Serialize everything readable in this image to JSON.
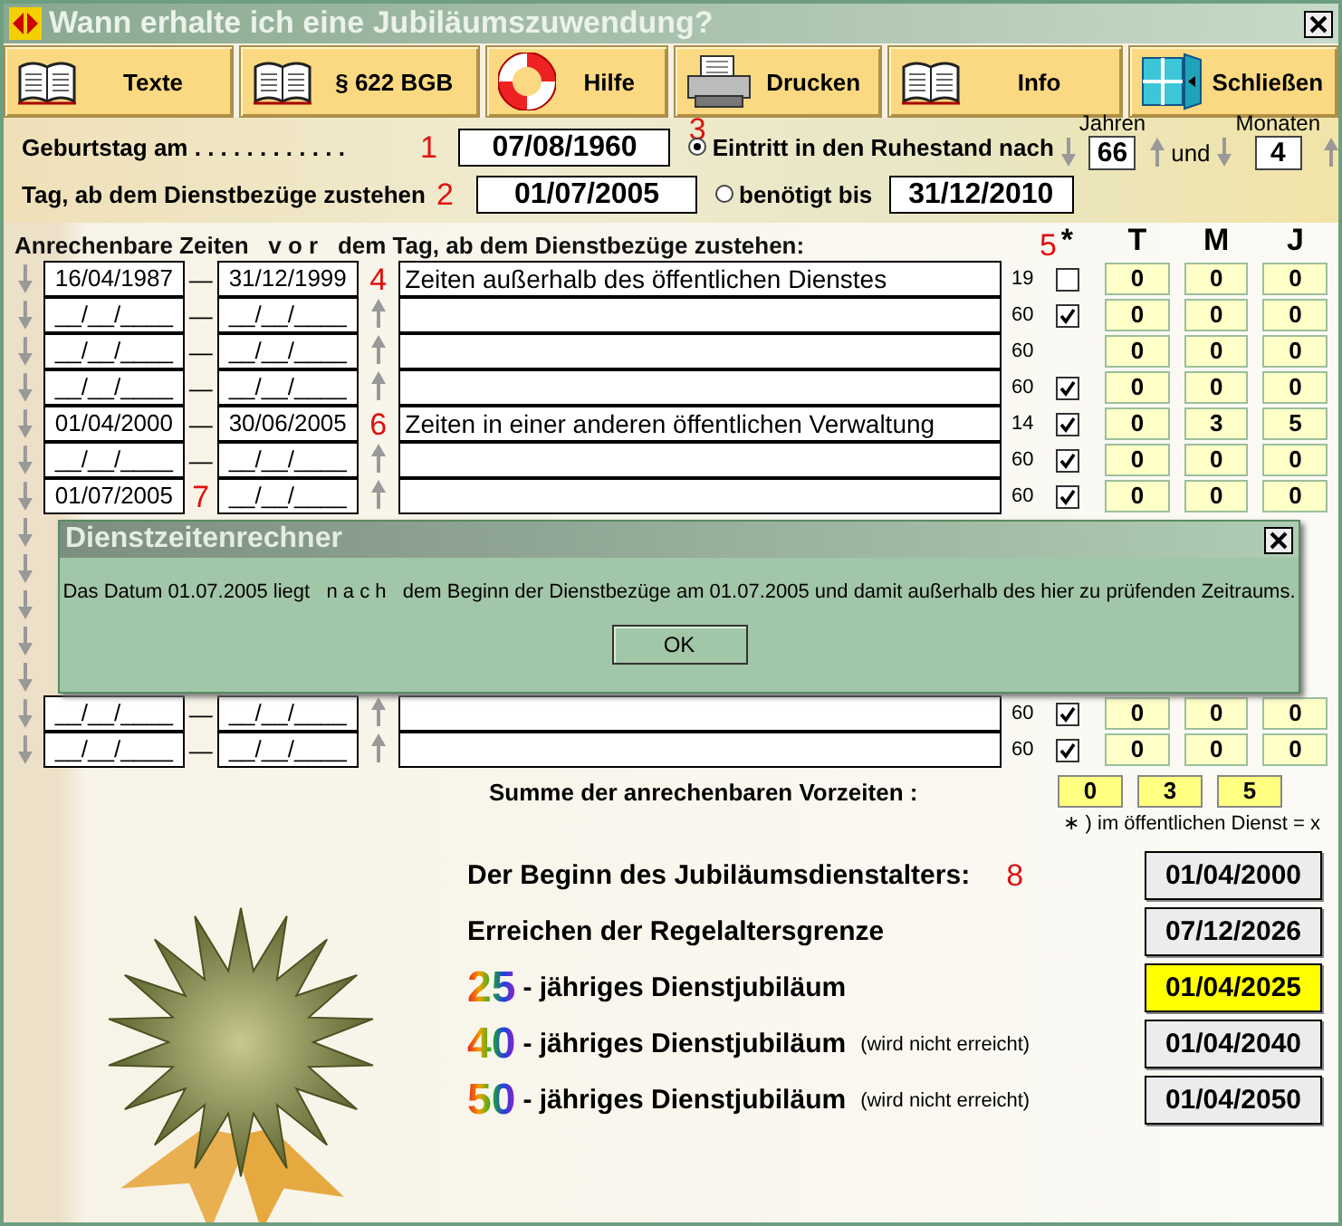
{
  "window": {
    "title": "Wann erhalte ich eine Jubiläumszuwendung?"
  },
  "toolbar": [
    {
      "label": "Texte"
    },
    {
      "label": "§ 622 BGB"
    },
    {
      "label": "Hilfe"
    },
    {
      "label": "Drucken"
    },
    {
      "label": "Info"
    },
    {
      "label": "Schließen"
    }
  ],
  "birthday": {
    "label": "Geburtstag am . . . . . . . . . . . .",
    "marker": "1",
    "value": "07/08/1960"
  },
  "pay_start": {
    "label": "Tag, ab dem Dienstbezüge zustehen",
    "marker": "2",
    "value": "01/07/2005"
  },
  "retirement": {
    "marker": "3",
    "options": [
      {
        "label": "Eintritt in den Ruhestand nach",
        "selected": true
      },
      {
        "label": "benötigt bis",
        "selected": false
      }
    ],
    "years_label": "Jahren",
    "years": "66",
    "and": "und",
    "months_label": "Monaten",
    "months": "4",
    "until": "31/12/2010"
  },
  "periods": {
    "heading": "Anrechenbare Zeiten   v o r   dem Tag, ab dem Dienstbezüge zustehen:",
    "star": "*",
    "star_marker": "5",
    "columns": [
      "T",
      "M",
      "J"
    ],
    "rows": [
      {
        "kind": "check",
        "from": "16/04/1987",
        "dash": "—",
        "to": "31/12/1999",
        "marker": "4",
        "text": "Zeiten außerhalb des öffentlichen Dienstes",
        "factor": "19",
        "checked": false,
        "t": "0",
        "m": "0",
        "j": "0"
      },
      {
        "kind": "check",
        "from": "__/__/____",
        "dash": "—",
        "to": "__/__/____",
        "factor": "60",
        "checked": true,
        "t": "0",
        "m": "0",
        "j": "0"
      },
      {
        "kind": "plain",
        "from": "__/__/____",
        "dash": "—",
        "to": "__/__/____",
        "factor": "60",
        "t": "0",
        "m": "0",
        "j": "0"
      },
      {
        "kind": "check",
        "from": "__/__/____",
        "dash": "—",
        "to": "__/__/____",
        "factor": "60",
        "checked": true,
        "t": "0",
        "m": "0",
        "j": "0"
      },
      {
        "kind": "check",
        "from": "01/04/2000",
        "dash": "—",
        "to": "30/06/2005",
        "marker": "6",
        "text": "Zeiten in einer anderen öffentlichen Verwaltung",
        "factor": "14",
        "checked": true,
        "t": "0",
        "m": "3",
        "j": "5"
      },
      {
        "kind": "check",
        "from": "__/__/____",
        "dash": "—",
        "to": "__/__/____",
        "factor": "60",
        "checked": true,
        "t": "0",
        "m": "0",
        "j": "0"
      },
      {
        "kind": "check",
        "from": "01/07/2005",
        "dash_marker": "7",
        "to": "__/__/____",
        "factor": "60",
        "checked": true,
        "t": "0",
        "m": "0",
        "j": "0"
      },
      {
        "kind": "covered"
      },
      {
        "kind": "covered"
      },
      {
        "kind": "covered"
      },
      {
        "kind": "covered"
      },
      {
        "kind": "covered"
      },
      {
        "kind": "check",
        "from": "__/__/____",
        "dash": "—",
        "to": "__/__/____",
        "factor": "60",
        "checked": true,
        "t": "0",
        "m": "0",
        "j": "0"
      },
      {
        "kind": "check",
        "from": "__/__/____",
        "dash": "—",
        "to": "__/__/____",
        "factor": "60",
        "checked": true,
        "t": "0",
        "m": "0",
        "j": "0"
      }
    ],
    "sum": {
      "label": "Summe der anrechenbaren Vorzeiten :",
      "t": "0",
      "m": "3",
      "j": "5"
    },
    "legend": "∗ ) im öffentlichen Dienst = x"
  },
  "results": [
    {
      "kind": "text",
      "label": "Der Beginn des Jubiläumsdienstalters:",
      "marker": "8",
      "value": "01/04/2000",
      "highlight": false
    },
    {
      "kind": "text",
      "label": "Erreichen der Regelaltersgrenze",
      "value": "07/12/2026",
      "highlight": false
    },
    {
      "kind": "jubilee",
      "number": "25",
      "label": "- jähriges Dienstjubiläum",
      "value": "01/04/2025",
      "highlight": true
    },
    {
      "kind": "jubilee",
      "number": "40",
      "label": "- jähriges Dienstjubiläum",
      "note": "(wird nicht erreicht)",
      "value": "01/04/2040",
      "highlight": false
    },
    {
      "kind": "jubilee",
      "number": "50",
      "label": "- jähriges Dienstjubiläum",
      "note": "(wird nicht erreicht)",
      "value": "01/04/2050",
      "highlight": false
    }
  ],
  "dialog": {
    "title": "Dienstzeitenrechner",
    "message": "Das Datum 01.07.2005 liegt   n a c h   dem Beginn der Dienstbezüge am 01.07.2005 und damit außerhalb des hier zu prüfenden Zeitraums.",
    "button": "OK"
  }
}
